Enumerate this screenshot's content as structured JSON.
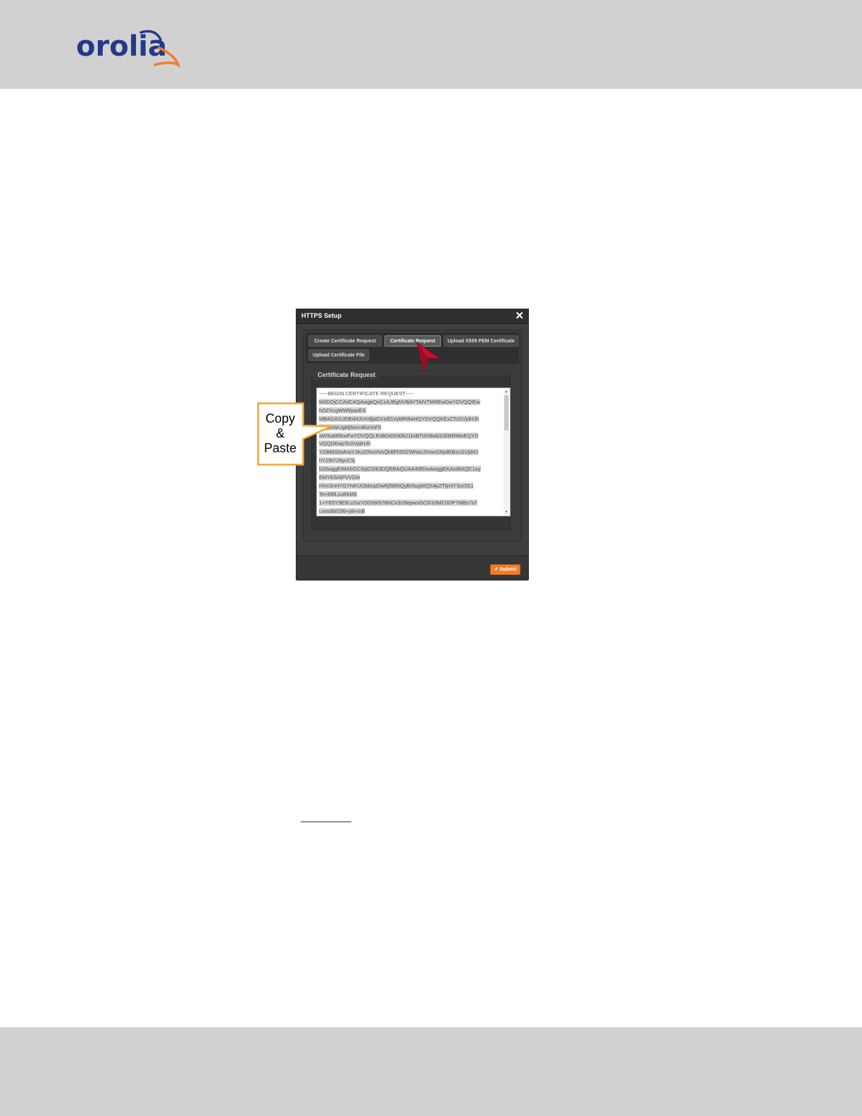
{
  "header": {
    "logo_text": "orolia"
  },
  "dialog": {
    "title": "HTTPS Setup",
    "tabs": [
      {
        "label": "Create Certificate Request"
      },
      {
        "label": "Certificate Request"
      },
      {
        "label": "Upload X509 PEM Certificate"
      },
      {
        "label": "Upload Certificate File"
      }
    ],
    "active_tab": "Certificate Request",
    "fieldset_legend": "Certificate Request",
    "certificate_lines": [
      "-----BEGIN CERTIFICATE REQUEST-----",
      "MIIDOjCCAiICAQAwgbQxCzAJBgNVBAYTAlVTMREwDwYDVQQIEw",
      "hOZXcgWW9yazES",
      "MBAGA1UEBxMJUm9jaGVzdGVyMR8wHQYDVQQKExZTcGVjdHJh",
      "IFRpbWUgMjNvcnBvcmF0",
      "aW9uMRkwFwYDVQQLExBOdXN0b21lciBTdXBwb3J0MRMwEQYD",
      "VQQDEwpTcGVjdHJh",
      "Y29tMS0wKwYJKoZIhvcNAQkBFh50ZWNoc3VwcG9ydEBzcGVjdHJ",
      "hY29tY29ycC5j",
      "b20wggEiMA0GCSqGSIb3DQEBAQUAA4IBDwAwggEKAoIBAQC1oy",
      "EMYE6/APVVD/e",
      "HVxSnHYGYNKUObbnpDwRjf5R0QyBr5ogWQS4p2TljmIYSo/3S1",
      "Te+89fLzuRkM5",
      "1+YE0Y9E9LcGaYOD58/978HCx3U9epwsGC5I10MC0OP7MBs7s7",
      "LemdW336+y8+mB"
    ],
    "submit_label": "✔ Submit"
  },
  "callout": {
    "line1": "Copy",
    "line2": "&",
    "line3": "Paste"
  },
  "colors": {
    "header_band": "#d1d1d1",
    "logo_blue": "#233a8a",
    "logo_orange": "#f07d2a",
    "callout_border": "#f0a632",
    "submit_orange": "#f07d2a",
    "pointer_red": "#c8102e"
  }
}
